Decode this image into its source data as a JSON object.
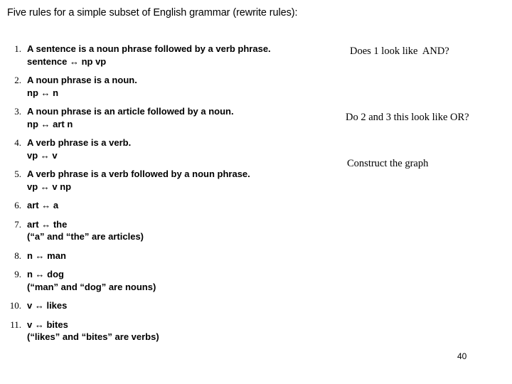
{
  "slide": {
    "title": "Five rules for a simple subset of English grammar (rewrite rules):",
    "page_number": "40",
    "background_color": "#ffffff",
    "text_color": "#000000"
  },
  "rules": [
    {
      "number": "1.",
      "description": "A sentence is a noun phrase followed by a verb phrase.",
      "production": "sentence ↔ np vp",
      "note": ""
    },
    {
      "number": "2.",
      "description": "A noun phrase is a noun.",
      "production": "np ↔ n",
      "note": ""
    },
    {
      "number": "3.",
      "description": "A noun phrase is an article followed by a noun.",
      "production": "np ↔ art n",
      "note": ""
    },
    {
      "number": "4.",
      "description": "A verb phrase is a verb.",
      "production": "vp ↔ v",
      "note": ""
    },
    {
      "number": "5.",
      "description": "A verb phrase is a verb followed by a noun phrase.",
      "production": "vp ↔ v np",
      "note": ""
    },
    {
      "number": "6.",
      "description": "",
      "production": "art ↔ a",
      "note": ""
    },
    {
      "number": "7.",
      "description": "",
      "production": "art ↔ the",
      "note": "(“a” and “the” are articles)"
    },
    {
      "number": "8.",
      "description": "",
      "production": "n ↔ man",
      "note": ""
    },
    {
      "number": "9.",
      "description": "",
      "production": "n ↔ dog",
      "note": "(“man” and “dog” are nouns)"
    },
    {
      "number": "10.",
      "description": "",
      "production": "v ↔ likes",
      "note": ""
    },
    {
      "number": "11.",
      "description": "",
      "production": "v ↔ bites",
      "note": "(“likes” and “bites” are verbs)"
    }
  ],
  "annotations": {
    "and_question": "Does 1 look like  AND?",
    "or_question": "Do 2 and 3 this look like OR?",
    "construct_graph": "Construct the graph"
  }
}
